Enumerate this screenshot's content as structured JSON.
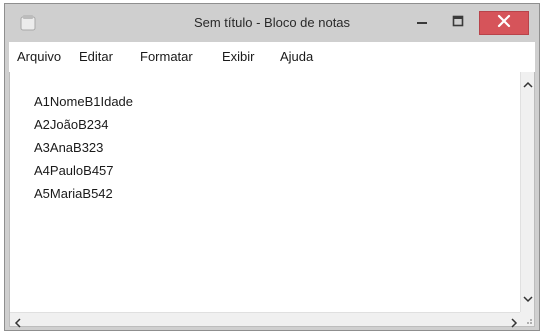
{
  "window": {
    "title": "Sem título - Bloco de notas",
    "controls": {
      "minimize_icon": "minimize-icon",
      "maximize_icon": "maximize-icon",
      "close_icon": "close-icon",
      "close_color": "#d6545a"
    }
  },
  "menu": {
    "items": [
      {
        "label": "Arquivo"
      },
      {
        "label": "Editar"
      },
      {
        "label": "Formatar"
      },
      {
        "label": "Exibir"
      },
      {
        "label": "Ajuda"
      }
    ]
  },
  "editor": {
    "lines": [
      "A1NomeB1Idade",
      "A2JoãoB234",
      "A3AnaB323",
      "A4PauloB457",
      "A5MariaB542"
    ]
  },
  "colors": {
    "window_frame": "#cfcfcf",
    "editor_background": "#ffffff",
    "text": "#1a1a1a"
  }
}
